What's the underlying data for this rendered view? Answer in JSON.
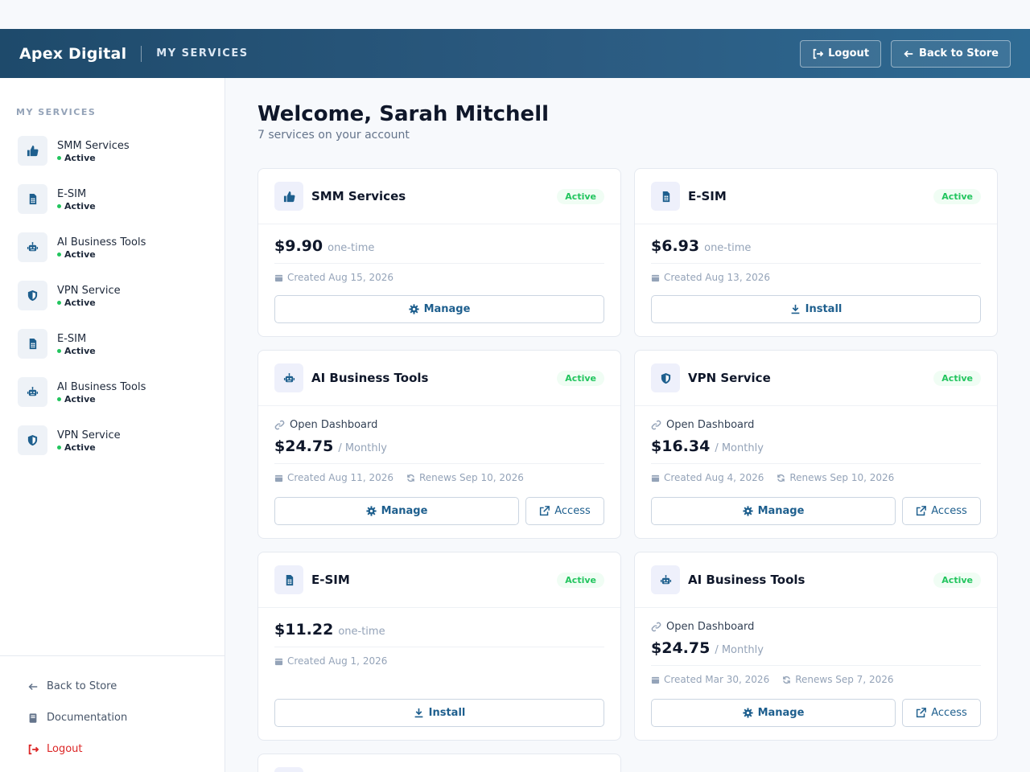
{
  "header": {
    "brand": "Apex Digital",
    "section": "MY SERVICES",
    "logout_label": "Logout",
    "back_label": "Back to Store"
  },
  "sidebar": {
    "title": "MY SERVICES",
    "items": [
      {
        "label": "SMM Services",
        "status": "Active",
        "icon": "thumbs-up-icon"
      },
      {
        "label": "E-SIM",
        "status": "Active",
        "icon": "sim-card-icon"
      },
      {
        "label": "AI Business Tools",
        "status": "Active",
        "icon": "robot-icon"
      },
      {
        "label": "VPN Service",
        "status": "Active",
        "icon": "shield-icon"
      },
      {
        "label": "E-SIM",
        "status": "Active",
        "icon": "sim-card-icon"
      },
      {
        "label": "AI Business Tools",
        "status": "Active",
        "icon": "robot-icon"
      },
      {
        "label": "VPN Service",
        "status": "Active",
        "icon": "shield-icon"
      }
    ],
    "footer": {
      "back": "Back to Store",
      "docs": "Documentation",
      "logout": "Logout"
    }
  },
  "main": {
    "title": "Welcome, Sarah Mitchell",
    "subtitle": "7 services on your account",
    "cards": [
      {
        "name": "SMM Services",
        "badge": "Active",
        "price": "$9.90",
        "period": "one-time",
        "created": "Created Aug 15, 2026",
        "action": "Manage"
      },
      {
        "name": "E-SIM",
        "badge": "Active",
        "price": "$6.93",
        "period": "one-time",
        "created": "Created Aug 13, 2026",
        "action": "Install"
      },
      {
        "name": "AI Business Tools",
        "badge": "Active",
        "dashboard": "Open Dashboard",
        "price": "$24.75",
        "period": "/ Monthly",
        "created": "Created Aug 11, 2026",
        "renews": "Renews Sep 10, 2026",
        "action": "Manage",
        "access": "Access"
      },
      {
        "name": "VPN Service",
        "badge": "Active",
        "dashboard": "Open Dashboard",
        "price": "$16.34",
        "period": "/ Monthly",
        "created": "Created Aug 4, 2026",
        "renews": "Renews Sep 10, 2026",
        "action": "Manage",
        "access": "Access"
      },
      {
        "name": "E-SIM",
        "badge": "Active",
        "price": "$11.22",
        "period": "one-time",
        "created": "Created Aug 1, 2026",
        "action": "Install"
      },
      {
        "name": "AI Business Tools",
        "badge": "Active",
        "dashboard": "Open Dashboard",
        "price": "$24.75",
        "period": "/ Monthly",
        "created": "Created Mar 30, 2026",
        "renews": "Renews Sep 7, 2026",
        "action": "Manage",
        "access": "Access"
      }
    ]
  },
  "colors": {
    "accent": "#1e5f8e",
    "active": "#22c55e",
    "logout": "#dc2626"
  }
}
